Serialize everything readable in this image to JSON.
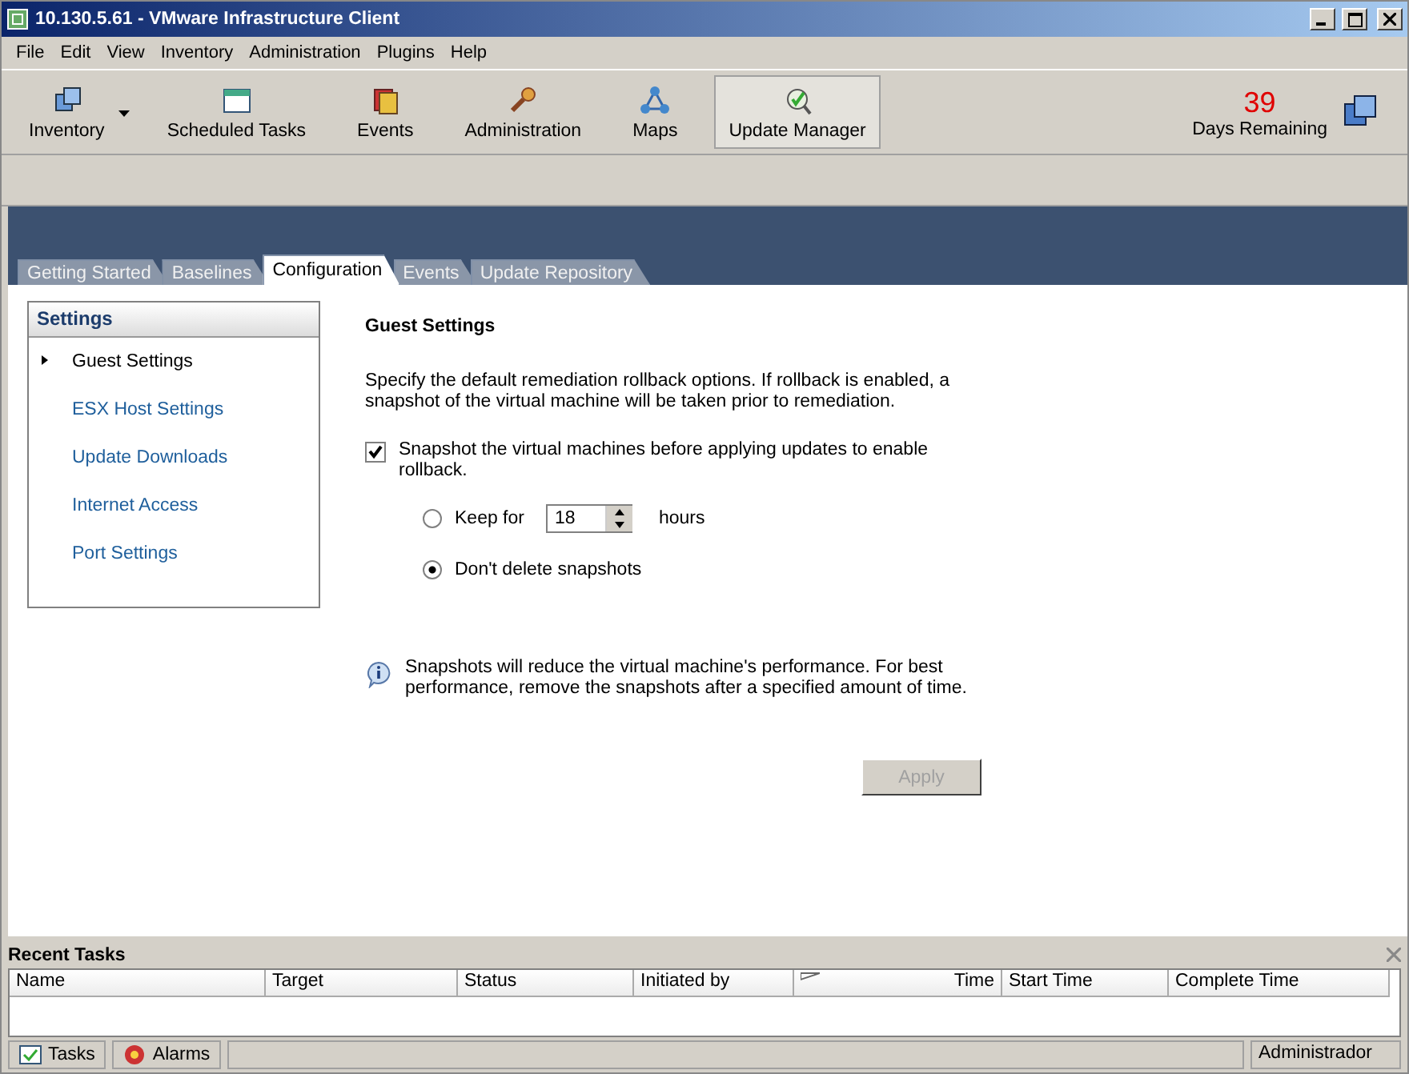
{
  "window": {
    "title": "10.130.5.61 - VMware Infrastructure Client"
  },
  "menu": [
    "File",
    "Edit",
    "View",
    "Inventory",
    "Administration",
    "Plugins",
    "Help"
  ],
  "toolbar": [
    {
      "label": "Inventory",
      "kind": "inventory",
      "selected": false,
      "dropdown": true
    },
    {
      "label": "Scheduled Tasks",
      "kind": "tasks",
      "selected": false,
      "dropdown": false
    },
    {
      "label": "Events",
      "kind": "events",
      "selected": false,
      "dropdown": false
    },
    {
      "label": "Administration",
      "kind": "admin",
      "selected": false,
      "dropdown": false
    },
    {
      "label": "Maps",
      "kind": "maps",
      "selected": false,
      "dropdown": false
    },
    {
      "label": "Update Manager",
      "kind": "update",
      "selected": true,
      "dropdown": false
    }
  ],
  "license": {
    "days": "39",
    "label": "Days Remaining"
  },
  "tabs": [
    {
      "label": "Getting Started",
      "selected": false
    },
    {
      "label": "Baselines",
      "selected": false
    },
    {
      "label": "Configuration",
      "selected": true
    },
    {
      "label": "Events",
      "selected": false
    },
    {
      "label": "Update Repository",
      "selected": false
    }
  ],
  "settings": {
    "title": "Settings",
    "items": [
      {
        "label": "Guest Settings",
        "selected": true
      },
      {
        "label": "ESX Host Settings",
        "selected": false
      },
      {
        "label": "Update Downloads",
        "selected": false
      },
      {
        "label": "Internet Access",
        "selected": false
      },
      {
        "label": "Port Settings",
        "selected": false
      }
    ]
  },
  "panel": {
    "heading": "Guest Settings",
    "description": "Specify the default remediation rollback options. If rollback is enabled, a snapshot of the virtual machine will be taken prior to remediation.",
    "snapshot": {
      "label": "Snapshot the virtual machines before applying updates to enable rollback.",
      "checked": true
    },
    "options": [
      {
        "kind": "keep",
        "label": "Keep for",
        "value": "18",
        "unit": "hours",
        "selected": false
      },
      {
        "kind": "plain",
        "label": "Don't delete snapshots",
        "selected": true
      }
    ],
    "info": "Snapshots will reduce the virtual machine's performance. For best performance, remove the snapshots after a specified amount of time.",
    "apply": {
      "label": "Apply",
      "disabled": true
    }
  },
  "recent_tasks": {
    "title": "Recent Tasks",
    "columns": [
      {
        "label": "Name",
        "sorted": false
      },
      {
        "label": "Target",
        "sorted": false
      },
      {
        "label": "Status",
        "sorted": false
      },
      {
        "label": "Initiated by",
        "sorted": false
      },
      {
        "label": "Time",
        "sorted": true
      },
      {
        "label": "Start Time",
        "sorted": false
      },
      {
        "label": "Complete Time",
        "sorted": false
      }
    ]
  },
  "status_bar": {
    "buttons": [
      "Tasks",
      "Alarms"
    ],
    "user": "Administrador"
  }
}
